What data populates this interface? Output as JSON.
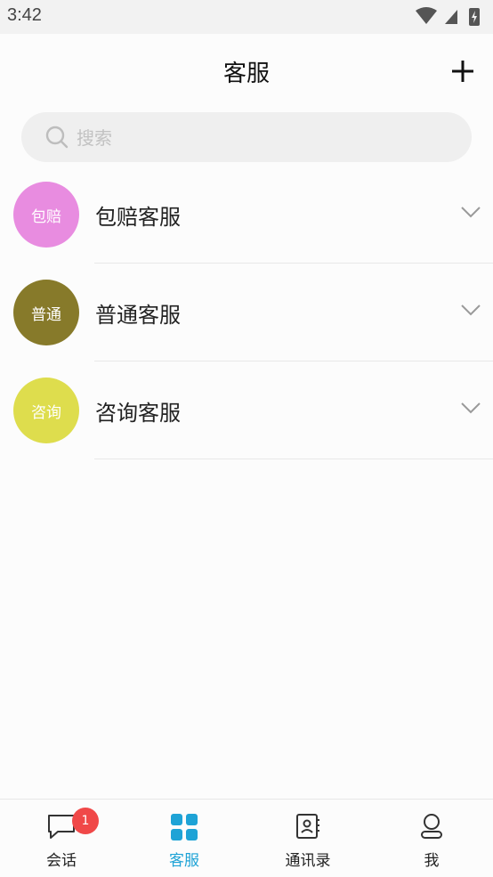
{
  "status_bar": {
    "time": "3:42"
  },
  "header": {
    "title": "客服"
  },
  "search": {
    "placeholder": "搜索",
    "value": ""
  },
  "service_groups": [
    {
      "avatar_text": "包赔",
      "label": "包赔客服",
      "avatar_color": "#e88ce0"
    },
    {
      "avatar_text": "普通",
      "label": "普通客服",
      "avatar_color": "#877a2a"
    },
    {
      "avatar_text": "咨询",
      "label": "咨询客服",
      "avatar_color": "#dedd4d"
    }
  ],
  "tabs": [
    {
      "label": "会话",
      "icon": "chat-bubble-icon",
      "badge": "1"
    },
    {
      "label": "客服",
      "icon": "grid-icon",
      "active": true
    },
    {
      "label": "通讯录",
      "icon": "contacts-book-icon"
    },
    {
      "label": "我",
      "icon": "person-icon"
    }
  ],
  "colors": {
    "accent": "#1ea3d6",
    "badge": "#f04848",
    "background": "#fcfcfc"
  }
}
